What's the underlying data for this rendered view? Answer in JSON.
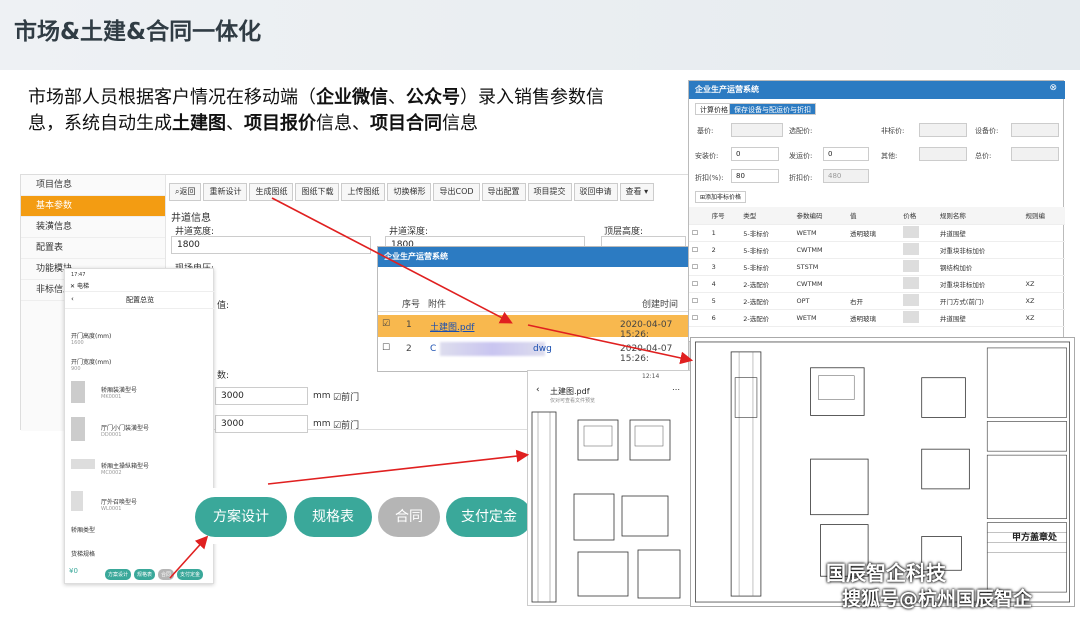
{
  "slide": {
    "title": "市场&土建&合同一体化",
    "desc_1": "市场部人员根据客户情况在移动端（",
    "desc_b1": "企业微信",
    "desc_2": "、",
    "desc_b2": "公众号",
    "desc_3": "）录入销售参数信息，系统自动生成",
    "desc_b3": "土建图",
    "desc_4": "、",
    "desc_b4": "项目报价",
    "desc_5": "信息、",
    "desc_b5": "项目合同",
    "desc_6": "信息"
  },
  "desktop": {
    "sidebar": [
      "项目信息",
      "基本参数",
      "装潢信息",
      "配置表",
      "功能模块",
      "非标信息"
    ],
    "toolbar": [
      "返回",
      "重新设计",
      "生成图纸",
      "图纸下载",
      "上传图纸",
      "切换梯形",
      "导出COD",
      "导出配置",
      "项目提交",
      "驳回申请",
      "查看 ▾"
    ],
    "section": "井道信息",
    "f_width_label": "井道宽度:",
    "f_width_value": "1800",
    "f_depth_label": "井道深度:",
    "f_depth_value": "1800",
    "f_top_label": "顶层高度:",
    "f_site_label": "现场电压:",
    "f_val_label": "值:",
    "f_num_label": "数:",
    "f_v1": "3000",
    "f_v2": "3000",
    "unit": "mm",
    "front_door": "前门"
  },
  "overlay": {
    "title": "企业生产运营系统",
    "col_no": "序号",
    "col_file": "附件",
    "col_time": "创建时间",
    "rows": [
      {
        "no": "1",
        "file": "土建图.pdf",
        "time": "2020-04-07 15:26:"
      },
      {
        "no": "2",
        "file": "C",
        "file_suffix": "dwg",
        "time": "2020-04-07 15:26:"
      }
    ]
  },
  "pricing": {
    "title": "企业生产运营系统",
    "tab1": "计算价格",
    "tab2": "保存设备与配运价与折扣",
    "l_base": "基价:",
    "l_opt": "选配价:",
    "l_nonstd": "非标价:",
    "l_equip": "设备价:",
    "l_install": "安装价:",
    "l_ship": "发运价:",
    "l_other": "其他:",
    "l_total": "总价:",
    "l_disc": "折扣(%):",
    "l_discprice": "折扣价:",
    "v_install": "0",
    "v_ship": "0",
    "v_disc": "80",
    "v_discprice": "480",
    "add_btn": "添加非标价格",
    "cols": [
      "序号",
      "类型",
      "参数编码",
      "值",
      "价格",
      "规则名称",
      "规则编"
    ],
    "rows": [
      [
        "1",
        "5-非标价",
        "WETM",
        "透明玻璃",
        "",
        "井道围壁",
        ""
      ],
      [
        "2",
        "5-非标价",
        "CWTMM",
        "",
        "",
        "对重块非标加价",
        ""
      ],
      [
        "3",
        "5-非标价",
        "STSTM",
        "",
        "",
        "钢结构加价",
        ""
      ],
      [
        "4",
        "2-选配价",
        "CWTMM",
        "",
        "",
        "对重块非标加价",
        "XZ"
      ],
      [
        "5",
        "2-选配价",
        "OPT",
        "右开",
        "",
        "开门方式(前门)",
        "XZ"
      ],
      [
        "6",
        "2-选配价",
        "WETM",
        "透明玻璃",
        "",
        "井道围壁",
        "XZ"
      ]
    ]
  },
  "mobile": {
    "status": "17:47",
    "app": "电梯",
    "page": "配置总览",
    "rows": [
      {
        "label": "开门高度(mm)",
        "value": "1600"
      },
      {
        "label": "开门宽度(mm)",
        "value": "900"
      },
      {
        "label": "轿厢装潢型号",
        "value": "MK0001"
      },
      {
        "label": "厅门小门装潢型号",
        "value": "DD0001"
      },
      {
        "label": "轿厢主操纵箱型号",
        "value": "MC0002"
      },
      {
        "label": "厅外召唤型号",
        "value": "WL0001"
      },
      {
        "label": "轿厢类型",
        "value": ""
      },
      {
        "label": "货梯规格",
        "value": ""
      }
    ],
    "price": "¥0",
    "btns": [
      "方案设计",
      "规格表",
      "合同",
      "支付定金"
    ]
  },
  "bigbtns": [
    "方案设计",
    "规格表",
    "合同",
    "支付定金"
  ],
  "pdf": {
    "title": "土建图.pdf",
    "sub": "仅对可查看文件预览",
    "time": "12:14"
  },
  "drawing": {
    "stamp": "甲方盖章处"
  },
  "watermark": {
    "line1": "国辰智企科技",
    "line2": "搜狐号@杭州国辰智企"
  },
  "colors": {
    "teal": "#3aa89a",
    "gray_btn": "#b5b5b5",
    "orange": "#f39c12",
    "blue_title": "#2c7bc2",
    "arrow": "#e02020"
  }
}
